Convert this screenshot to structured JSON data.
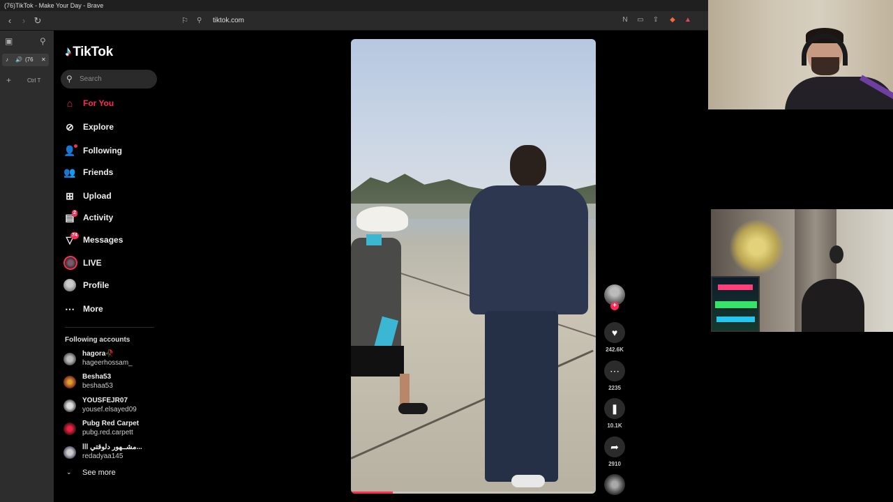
{
  "window": {
    "title": "(76)TikTok - Make Your Day - Brave"
  },
  "browser": {
    "url": "tiktok.com",
    "tab": {
      "count_label": "(76"
    },
    "new_tab_shortcut": "Ctrl T"
  },
  "tiktok": {
    "logo_text": "TikTok",
    "search_placeholder": "Search",
    "nav": [
      {
        "label": "For You",
        "icon": "home-icon",
        "active": true
      },
      {
        "label": "Explore",
        "icon": "compass-icon"
      },
      {
        "label": "Following",
        "icon": "following-icon"
      },
      {
        "label": "Friends",
        "icon": "friends-icon"
      },
      {
        "label": "Upload",
        "icon": "upload-icon"
      },
      {
        "label": "Activity",
        "icon": "activity-icon",
        "badge": "2"
      },
      {
        "label": "Messages",
        "icon": "messages-icon",
        "badge": "74"
      },
      {
        "label": "LIVE",
        "icon": "live-avatar"
      },
      {
        "label": "Profile",
        "icon": "profile-avatar"
      },
      {
        "label": "More",
        "icon": "more-icon"
      }
    ],
    "following_title": "Following accounts",
    "accounts": [
      {
        "display": "hagora🥀",
        "username": "hageerhossam_"
      },
      {
        "display": "Besha53",
        "username": "beshaa53"
      },
      {
        "display": "YOUSFEJR07",
        "username": "yousef.elsayed09"
      },
      {
        "display": "Pubg Red Carpet",
        "username": "pubg.red.carpett"
      },
      {
        "display": "مشــهور دلوقتي ااا...",
        "username": "redadyaa145"
      }
    ],
    "see_more": "See more",
    "actions": {
      "likes": "242.6K",
      "comments": "2235",
      "saves": "10.1K",
      "shares": "2910"
    },
    "video_progress": 0.17
  },
  "colors": {
    "accent": "#fe2c55",
    "background": "#000000"
  }
}
